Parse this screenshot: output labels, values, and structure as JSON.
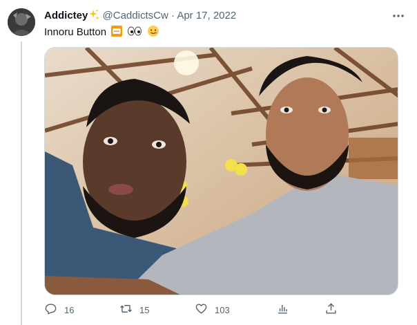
{
  "tweet": {
    "display_name": "Addictey",
    "handle": "@CaddictsCw",
    "separator": "·",
    "date": "Apr 17, 2022",
    "text": "Innoru Button"
  },
  "actions": {
    "replies": "16",
    "retweets": "15",
    "likes": "103"
  },
  "icons": {
    "verified_sparkle": "sparkles-icon",
    "more": "more-horizontal-icon",
    "reply": "reply-icon",
    "retweet": "retweet-icon",
    "like": "heart-icon",
    "views": "analytics-icon",
    "share": "share-icon",
    "emoji_1": "off-button-icon",
    "emoji_2": "eyes-icon",
    "emoji_3": "smiling-face-with-tear-icon"
  },
  "colors": {
    "text_primary": "#0f1419",
    "text_secondary": "#536471",
    "border": "#cfd9de"
  }
}
